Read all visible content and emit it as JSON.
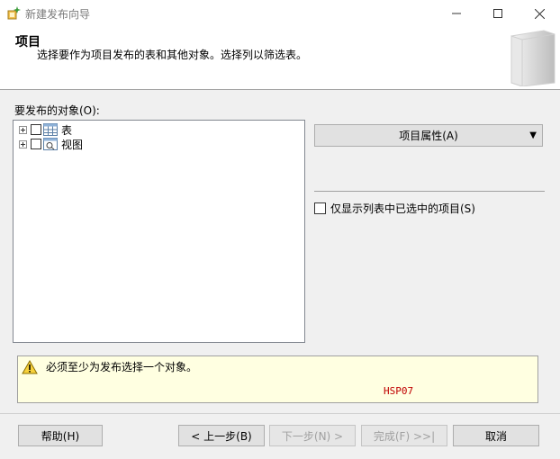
{
  "window": {
    "title": "新建发布向导"
  },
  "header": {
    "title": "项目",
    "subtitle": "选择要作为项目发布的表和其他对象。选择列以筛选表。"
  },
  "objects": {
    "label": "要发布的对象(O):",
    "tree": [
      {
        "label": "表",
        "icon": "table-icon",
        "checked": false,
        "expanded": false
      },
      {
        "label": "视图",
        "icon": "view-icon",
        "checked": false,
        "expanded": false
      }
    ]
  },
  "article_properties": {
    "label": "项目属性(A)",
    "arrow": "▼"
  },
  "only_selected": {
    "label": "仅显示列表中已选中的项目(S)",
    "checked": false
  },
  "message": {
    "text": "必须至少为发布选择一个对象。",
    "server": "HSP07"
  },
  "buttons": {
    "help": "帮助(H)",
    "back": "< 上一步(B)",
    "next": "下一步(N) >",
    "finish": "完成(F) >>|",
    "cancel": "取消"
  },
  "colors": {
    "warning_bg": "#ffffe1",
    "server_text": "#c00000"
  }
}
